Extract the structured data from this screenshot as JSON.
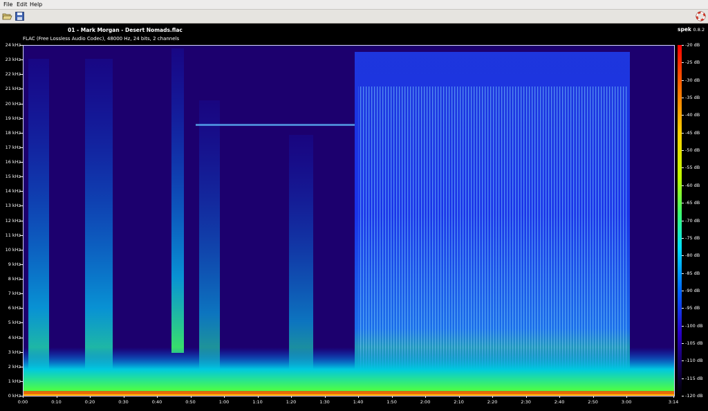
{
  "menu": {
    "file": "File",
    "edit": "Edit",
    "help": "Help"
  },
  "toolbar": {
    "open_icon": "folder-open-icon",
    "save_icon": "save-icon",
    "about_icon": "lifebuoy-icon"
  },
  "track": {
    "title": "01 - Mark Morgan - Desert Nomads.flac",
    "info": "FLAC (Free Lossless Audio Codec), 48000 Hz, 24 bits, 2 channels"
  },
  "app": {
    "name": "spek",
    "version": "0.8.2"
  },
  "freq_axis": {
    "labels": [
      "0 kHz",
      "1 kHz",
      "2 kHz",
      "3 kHz",
      "4 kHz",
      "5 kHz",
      "6 kHz",
      "7 kHz",
      "8 kHz",
      "9 kHz",
      "10 kHz",
      "11 kHz",
      "12 kHz",
      "13 kHz",
      "14 kHz",
      "15 kHz",
      "16 kHz",
      "17 kHz",
      "18 kHz",
      "19 kHz",
      "20 kHz",
      "21 kHz",
      "22 kHz",
      "23 kHz",
      "24 kHz"
    ]
  },
  "time_axis": {
    "labels": [
      "0:00",
      "0:10",
      "0:20",
      "0:30",
      "0:40",
      "0:50",
      "1:00",
      "1:10",
      "1:20",
      "1:30",
      "1:40",
      "1:50",
      "2:00",
      "2:10",
      "2:20",
      "2:30",
      "2:40",
      "2:50",
      "3:00",
      "3:14"
    ]
  },
  "db_scale": {
    "labels": [
      "-20 dB",
      "-25 dB",
      "-30 dB",
      "-35 dB",
      "-40 dB",
      "-45 dB",
      "-50 dB",
      "-55 dB",
      "-60 dB",
      "-65 dB",
      "-70 dB",
      "-75 dB",
      "-80 dB",
      "-85 dB",
      "-90 dB",
      "-95 dB",
      "-100 dB",
      "-105 dB",
      "-110 dB",
      "-115 dB",
      "-120 dB"
    ]
  },
  "colors": {
    "background": "#1c006e",
    "low_band": "#30ff60",
    "mid": "#00a8ff"
  }
}
